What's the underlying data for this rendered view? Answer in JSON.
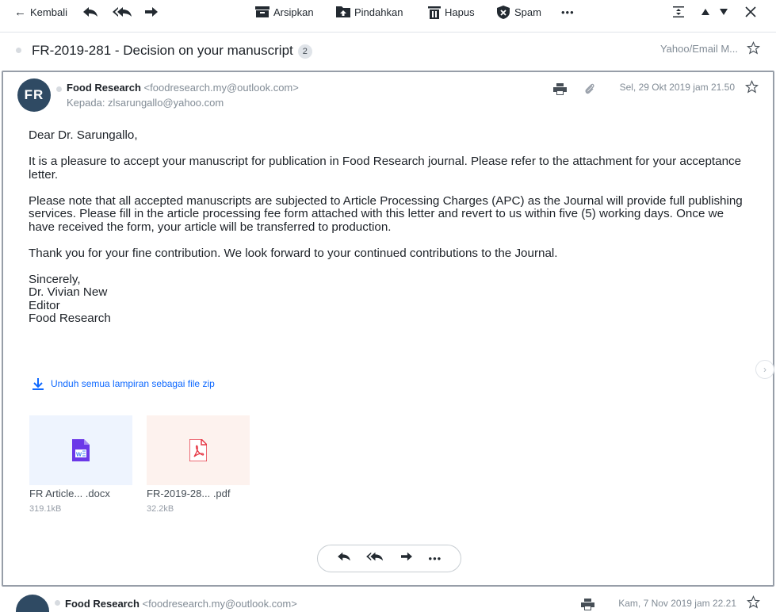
{
  "toolbar": {
    "back_label": "Kembali",
    "archive_label": "Arsipkan",
    "move_label": "Pindahkan",
    "delete_label": "Hapus",
    "spam_label": "Spam",
    "more_label": "•••"
  },
  "thread": {
    "subject": "FR-2019-281 - Decision on your manuscript",
    "count": "2",
    "folder": "Yahoo/Email M..."
  },
  "message1": {
    "avatar_initials": "FR",
    "sender_name": "Food Research",
    "sender_email": "<foodresearch.my@outlook.com>",
    "to": "Kepada: zlsarungallo@yahoo.com",
    "date": "Sel, 29 Okt 2019 jam 21.50",
    "body": {
      "greeting": "Dear Dr. Sarungallo,",
      "p1": "It is a pleasure to accept your manuscript for publication in Food Research journal. Please refer to the attachment for your acceptance letter.",
      "p2": "Please note that all accepted manuscripts are subjected to Article Processing Charges (APC) as the Journal will provide full publishing services. Please fill in the article processing fee form attached with this letter and revert to us within five (5) working days. Once we have received the form, your article will be transferred to production.",
      "p3": "Thank you for your fine contribution. We look forward to your continued contributions to the Journal.",
      "sign1": "Sincerely,",
      "sign2": "Dr. Vivian New",
      "sign3": "Editor",
      "sign4": "Food Research"
    },
    "download_zip": "Unduh semua lampiran sebagai file zip",
    "attachments": [
      {
        "name": "FR Article... .docx",
        "size": "319.1kB",
        "type": "word"
      },
      {
        "name": "FR-2019-28... .pdf",
        "size": "32.2kB",
        "type": "pdf"
      }
    ]
  },
  "message2": {
    "sender_name": "Food Research",
    "sender_email": "<foodresearch.my@outlook.com>",
    "date": "Kam, 7 Nov 2019 jam 22.21"
  },
  "colors": {
    "accent": "#0f69ff",
    "avatar_bg": "#2f4a63",
    "muted": "#828c96"
  }
}
